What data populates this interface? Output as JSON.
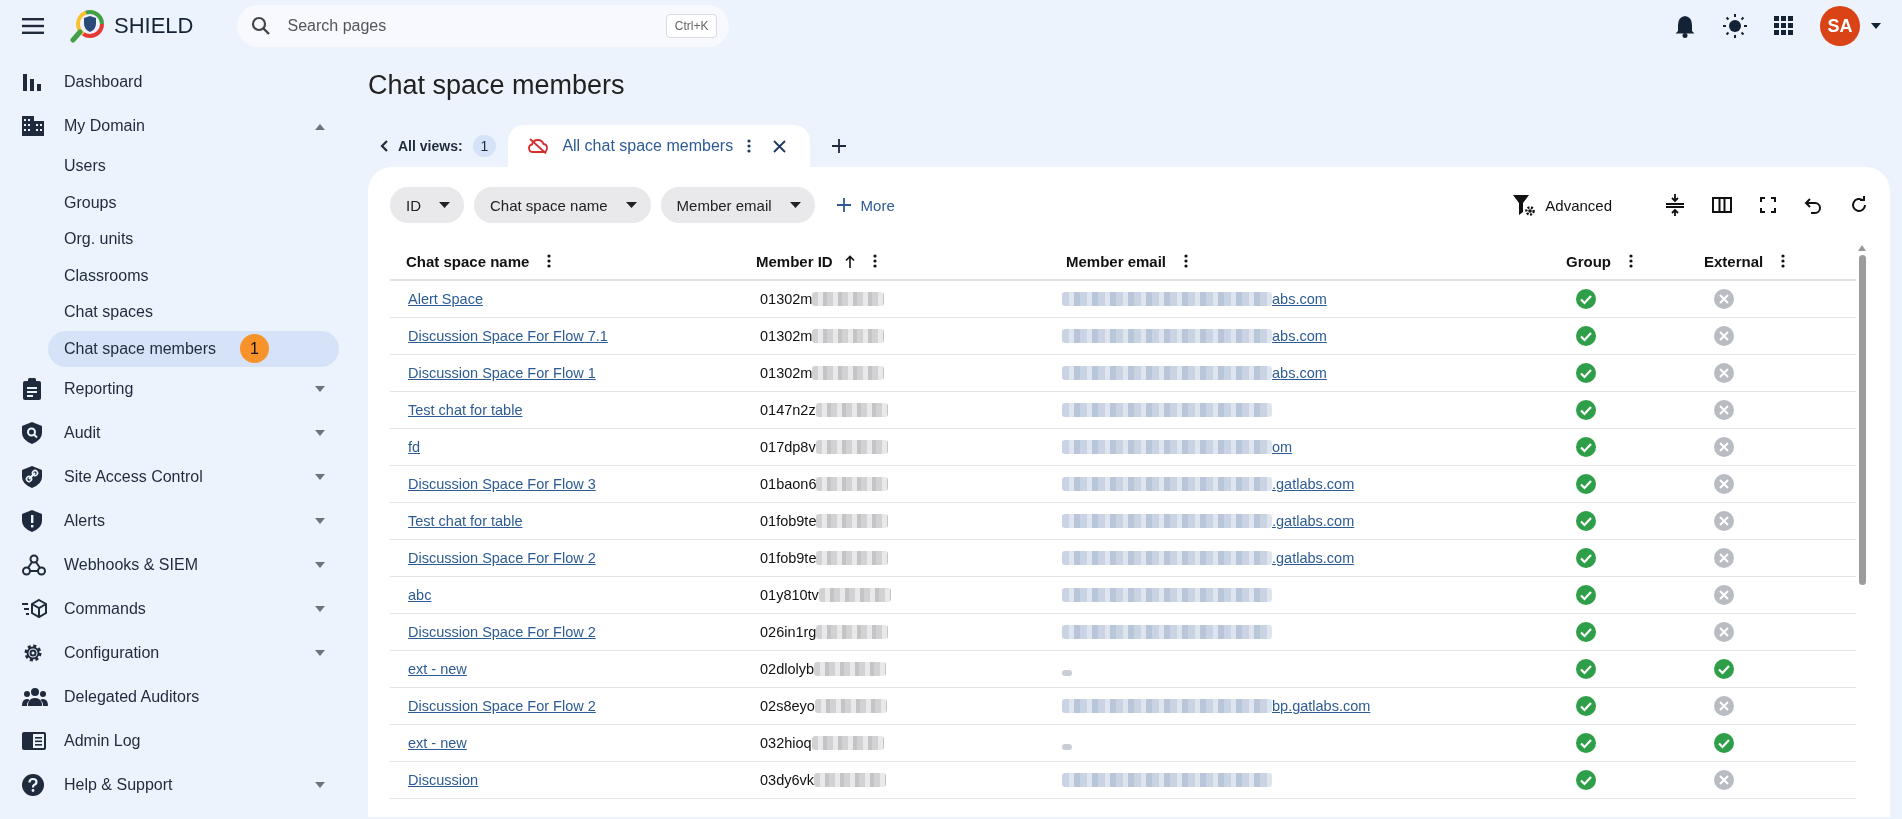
{
  "app": {
    "name": "SHIELD",
    "search": {
      "placeholder": "Search pages",
      "shortcut": "Ctrl+K"
    },
    "user_initials": "SA"
  },
  "sidebar": {
    "items": [
      {
        "label": "Dashboard"
      },
      {
        "label": "My Domain",
        "expanded": true,
        "children": [
          {
            "label": "Users",
            "selected": false
          },
          {
            "label": "Groups",
            "selected": false
          },
          {
            "label": "Org. units",
            "selected": false
          },
          {
            "label": "Classrooms",
            "selected": false
          },
          {
            "label": "Chat spaces",
            "selected": false
          },
          {
            "label": "Chat space members",
            "selected": true,
            "badge": "1"
          }
        ]
      },
      {
        "label": "Reporting",
        "expanded": false
      },
      {
        "label": "Audit",
        "expanded": false
      },
      {
        "label": "Site Access Control",
        "expanded": false
      },
      {
        "label": "Alerts",
        "expanded": false
      },
      {
        "label": "Webhooks & SIEM",
        "expanded": false
      },
      {
        "label": "Commands",
        "expanded": false
      },
      {
        "label": "Configuration",
        "expanded": false
      },
      {
        "label": "Delegated Auditors"
      },
      {
        "label": "Admin Log"
      },
      {
        "label": "Help & Support",
        "expanded": false
      }
    ]
  },
  "page": {
    "title": "Chat space members",
    "views": {
      "label": "All views:",
      "count": "1"
    },
    "tabs": [
      {
        "label": "All chat space members",
        "selected": true
      }
    ],
    "filters": [
      {
        "label": "ID"
      },
      {
        "label": "Chat space name"
      },
      {
        "label": "Member email"
      }
    ],
    "more_label": "More",
    "advanced_label": "Advanced",
    "table": {
      "columns": [
        {
          "label": "Chat space name"
        },
        {
          "label": "Member ID",
          "sort_ascending": true
        },
        {
          "label": "Member email"
        },
        {
          "label": "Group"
        },
        {
          "label": "External"
        }
      ],
      "rows": [
        {
          "name": "Alert Space",
          "member_id": "01302m",
          "email": "abs.com",
          "group": true,
          "external": false
        },
        {
          "name": "Discussion Space For Flow 7.1",
          "member_id": "01302m",
          "email": "abs.com",
          "group": true,
          "external": false
        },
        {
          "name": "Discussion Space For Flow 1",
          "member_id": "01302m",
          "email": "abs.com",
          "group": true,
          "external": false
        },
        {
          "name": "Test chat for table",
          "member_id": "0147n2z",
          "group": true,
          "external": false
        },
        {
          "name": "fd",
          "member_id": "017dp8v",
          "email": "om",
          "group": true,
          "external": false
        },
        {
          "name": "Discussion Space For Flow 3",
          "member_id": "01baon6",
          "email": ".gatlabs.com",
          "group": true,
          "external": false
        },
        {
          "name": "Test chat for table",
          "member_id": "01fob9te",
          "email": ".gatlabs.com",
          "group": true,
          "external": false
        },
        {
          "name": "Discussion Space For Flow 2",
          "member_id": "01fob9te",
          "email": ".gatlabs.com",
          "group": true,
          "external": false
        },
        {
          "name": "abc",
          "member_id": "01y810tv",
          "group": true,
          "external": false
        },
        {
          "name": "Discussion Space For Flow 2",
          "member_id": "026in1rg",
          "group": true,
          "external": false
        },
        {
          "name": "ext - new",
          "member_id": "02dlolyb",
          "group": true,
          "external": true
        },
        {
          "name": "Discussion Space For Flow 2",
          "member_id": "02s8eyo",
          "email": "bp.gatlabs.com",
          "group": true,
          "external": false
        },
        {
          "name": "ext - new",
          "member_id": "032hioq",
          "group": true,
          "external": true
        },
        {
          "name": "Discussion",
          "member_id": "03dy6vk",
          "group": true,
          "external": false
        }
      ]
    }
  }
}
